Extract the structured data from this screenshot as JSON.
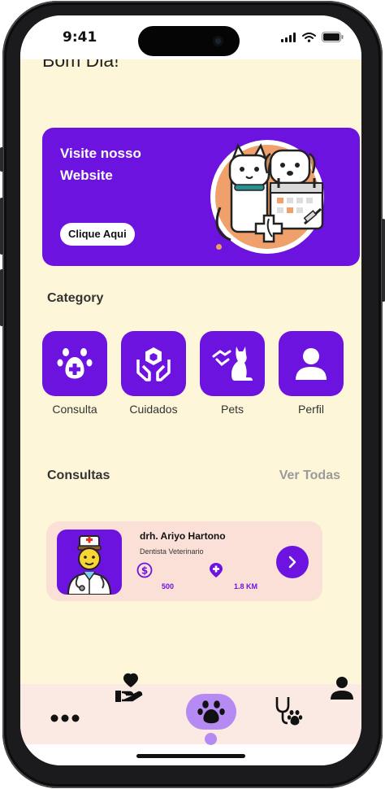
{
  "status_bar": {
    "time": "9:41"
  },
  "greeting": "Bom Dia!",
  "banner": {
    "title": "Visite nosso Website",
    "button_label": "Clique Aqui"
  },
  "category": {
    "title": "Category",
    "items": [
      {
        "label": "Consulta",
        "icon": "paw-plus-icon"
      },
      {
        "label": "Cuidados",
        "icon": "care-hands-icon"
      },
      {
        "label": "Pets",
        "icon": "cat-icon"
      },
      {
        "label": "Perfil",
        "icon": "user-icon"
      }
    ]
  },
  "consultas": {
    "title": "Consultas",
    "see_all": "Ver Todas",
    "card": {
      "name": "drh. Ariyo Hartono",
      "role": "Dentista Veterinario",
      "price": "500",
      "distance": "1.8 KM"
    }
  },
  "bottom_nav": [
    {
      "icon": "more-dots-icon"
    },
    {
      "icon": "heart-hand-icon"
    },
    {
      "icon": "paw-icon",
      "active": true
    },
    {
      "icon": "stethoscope-icon"
    },
    {
      "icon": "user-icon"
    }
  ],
  "colors": {
    "background": "#fdf6d8",
    "accent": "#6d13e0",
    "card": "#fbe0d8",
    "nav_active": "#b58af3",
    "banner_dot": "#e8a35a"
  }
}
